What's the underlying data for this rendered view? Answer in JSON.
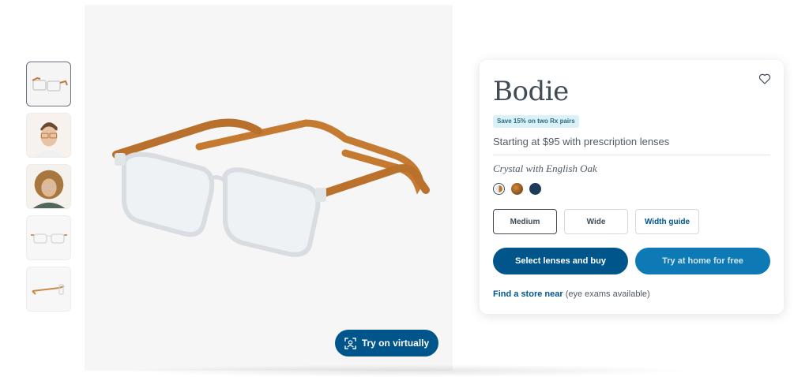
{
  "thumbnails": [
    {
      "icon": "glasses-angle-thumbnail"
    },
    {
      "icon": "model-man-thumbnail"
    },
    {
      "icon": "model-woman-thumbnail"
    },
    {
      "icon": "glasses-front-thumbnail"
    },
    {
      "icon": "glasses-side-thumbnail"
    }
  ],
  "hero": {
    "try_on_label": "Try on virtually"
  },
  "product": {
    "name": "Bodie",
    "badge": "Save 15% on two Rx pairs",
    "price_text": "Starting at $95 with prescription lenses",
    "color_name": "Crystal with English Oak",
    "swatches": [
      {
        "name": "Crystal with English Oak",
        "colors": [
          "#e7e7e7",
          "#b8742e"
        ],
        "selected": true
      },
      {
        "name": "Tortoise",
        "colors": [
          "#d28a3a",
          "#5e3210"
        ],
        "selected": false
      },
      {
        "name": "Navy",
        "colors": [
          "#1d3c5c"
        ],
        "selected": false
      }
    ],
    "sizes": {
      "medium": "Medium",
      "wide": "Wide",
      "width_guide": "Width guide"
    },
    "cta": {
      "primary": "Select lenses and buy",
      "secondary": "Try at home for free"
    },
    "store": {
      "link": "Find a store near",
      "note": " (eye exams available)"
    }
  },
  "colors": {
    "brand": "#00558b",
    "text": "#414b56",
    "badge_bg": "#daf2f7"
  }
}
